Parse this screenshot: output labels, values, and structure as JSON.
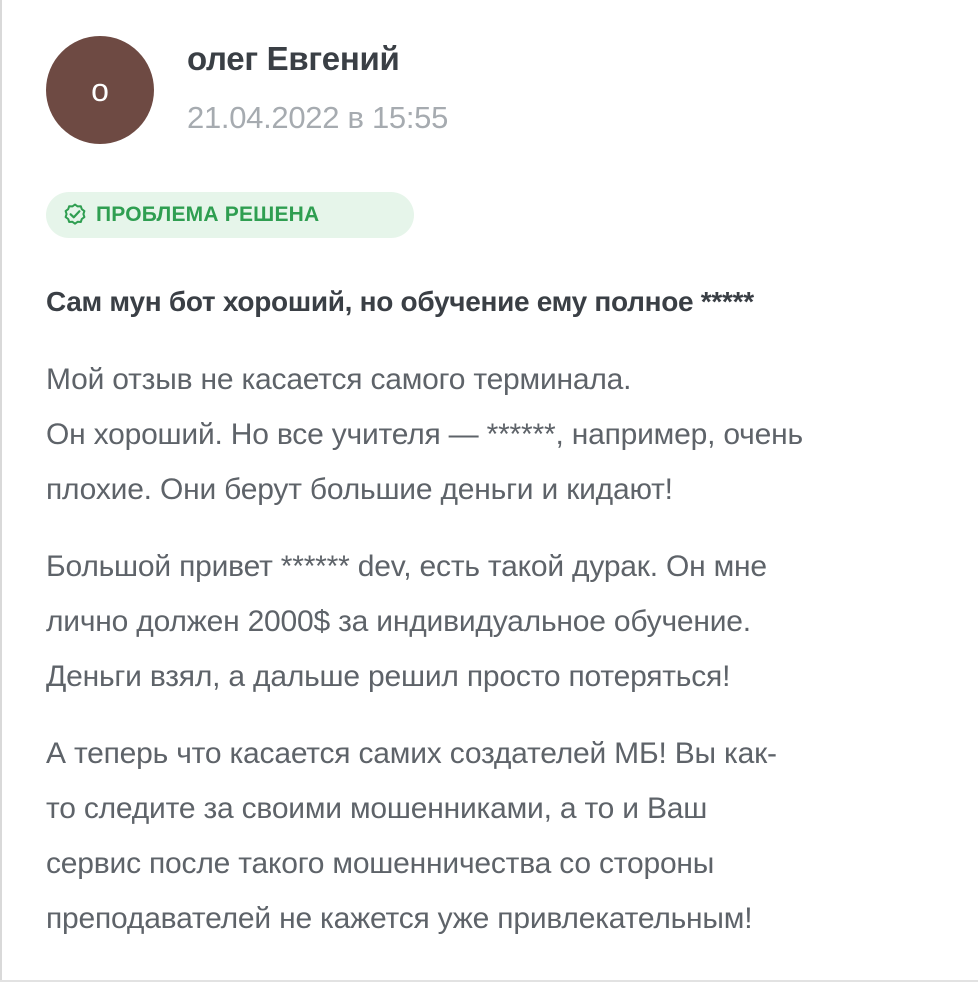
{
  "review": {
    "avatar_letter": "о",
    "author": "олег Евгений",
    "date": "21.04.2022 в 15:55",
    "status_badge": "ПРОБЛЕМА РЕШЕНА",
    "status_icon": "check-badge-icon",
    "title": "Сам мун бот хороший, но обучение ему полное *****",
    "paragraphs": [
      {
        "lines": [
          "Мой отзыв не касается самого терминала.",
          "Он хороший. Но все учителя — ******, например, очень",
          "плохие. Они берут большие деньги и кидают!"
        ]
      },
      {
        "lines": [
          "Большой привет ****** dev, есть такой дурак. Он мне",
          "лично должен 2000$ за индивидуальное обучение.",
          "Деньги взял, а дальше решил просто потеряться!"
        ]
      },
      {
        "lines": [
          "А теперь что касается самих создателей МБ! Вы как-",
          "то следите за своими мошенниками, а то и Ваш",
          "сервис после такого мошенничества со стороны",
          "преподавателей не кажется уже привлекательным!"
        ]
      }
    ]
  },
  "colors": {
    "avatar_bg": "#6e4a43",
    "badge_bg": "#e6f5ea",
    "badge_text": "#2f9e51",
    "text_primary": "#3a3f45",
    "text_secondary": "#5e6369",
    "text_muted": "#a6abb0"
  }
}
